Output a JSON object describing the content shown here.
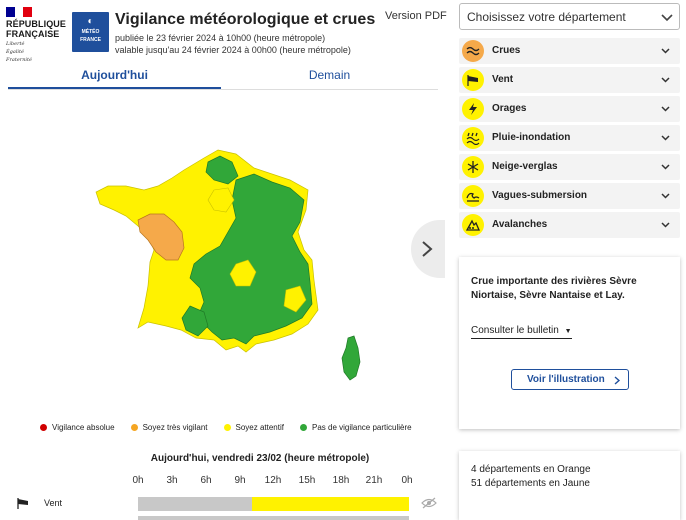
{
  "header": {
    "org_name_line1": "RÉPUBLIQUE",
    "org_name_line2": "FRANÇAISE",
    "motto_1": "Liberté",
    "motto_2": "Égalité",
    "motto_3": "Fraternité",
    "mf_logo_line1": "MÉTÉO",
    "mf_logo_line2": "FRANCE",
    "title": "Vigilance météorologique et crues",
    "published": "publiée le 23 février 2024 à 10h00 (heure métropole)",
    "valid_until": "valable jusqu'au 24 février 2024 à 00h00 (heure métropole)",
    "pdf_link": "Version PDF"
  },
  "tabs": [
    {
      "label": "Aujourd'hui"
    },
    {
      "label": "Demain"
    }
  ],
  "legend": [
    {
      "label": "Vigilance absolue",
      "color": "#d00000"
    },
    {
      "label": "Soyez très vigilant",
      "color": "#f5a623"
    },
    {
      "label": "Soyez attentif",
      "color": "#fff200"
    },
    {
      "label": "Pas de vigilance particulière",
      "color": "#31a739"
    }
  ],
  "map": {
    "colors": {
      "green": "#31a739",
      "yellow": "#fff200",
      "orange": "#f5a94a"
    }
  },
  "timeline": {
    "title": "Aujourd'hui, vendredi 23/02 (heure métropole)",
    "hours": [
      "0h",
      "3h",
      "6h",
      "9h",
      "12h",
      "15h",
      "18h",
      "21h",
      "0h"
    ],
    "rows": [
      {
        "label": "Vent",
        "icon": "wind-icon",
        "past_fraction": 0.42,
        "level": "yellow"
      }
    ]
  },
  "department_select": {
    "placeholder": "Choisissez votre département"
  },
  "risks": [
    {
      "label": "Crues",
      "icon": "flood-icon",
      "level": "orange",
      "color": "#f5a94a"
    },
    {
      "label": "Vent",
      "icon": "wind-icon",
      "level": "yellow",
      "color": "#fff200"
    },
    {
      "label": "Orages",
      "icon": "storm-icon",
      "level": "yellow",
      "color": "#fff200"
    },
    {
      "label": "Pluie-inondation",
      "icon": "rain-flood-icon",
      "level": "yellow",
      "color": "#fff200"
    },
    {
      "label": "Neige-verglas",
      "icon": "snow-ice-icon",
      "level": "yellow",
      "color": "#fff200"
    },
    {
      "label": "Vagues-submersion",
      "icon": "waves-icon",
      "level": "yellow",
      "color": "#fff200"
    },
    {
      "label": "Avalanches",
      "icon": "avalanche-icon",
      "level": "yellow",
      "color": "#fff200"
    }
  ],
  "flood_card": {
    "message": "Crue importante des rivières Sèvre Niortaise, Sèvre Nantaise et Lay.",
    "bulletin_label": "Consulter le bulletin",
    "button_label": "Voir l'illustration"
  },
  "stats": {
    "orange": "4 départements en Orange",
    "yellow": "51 départements en Jaune"
  }
}
